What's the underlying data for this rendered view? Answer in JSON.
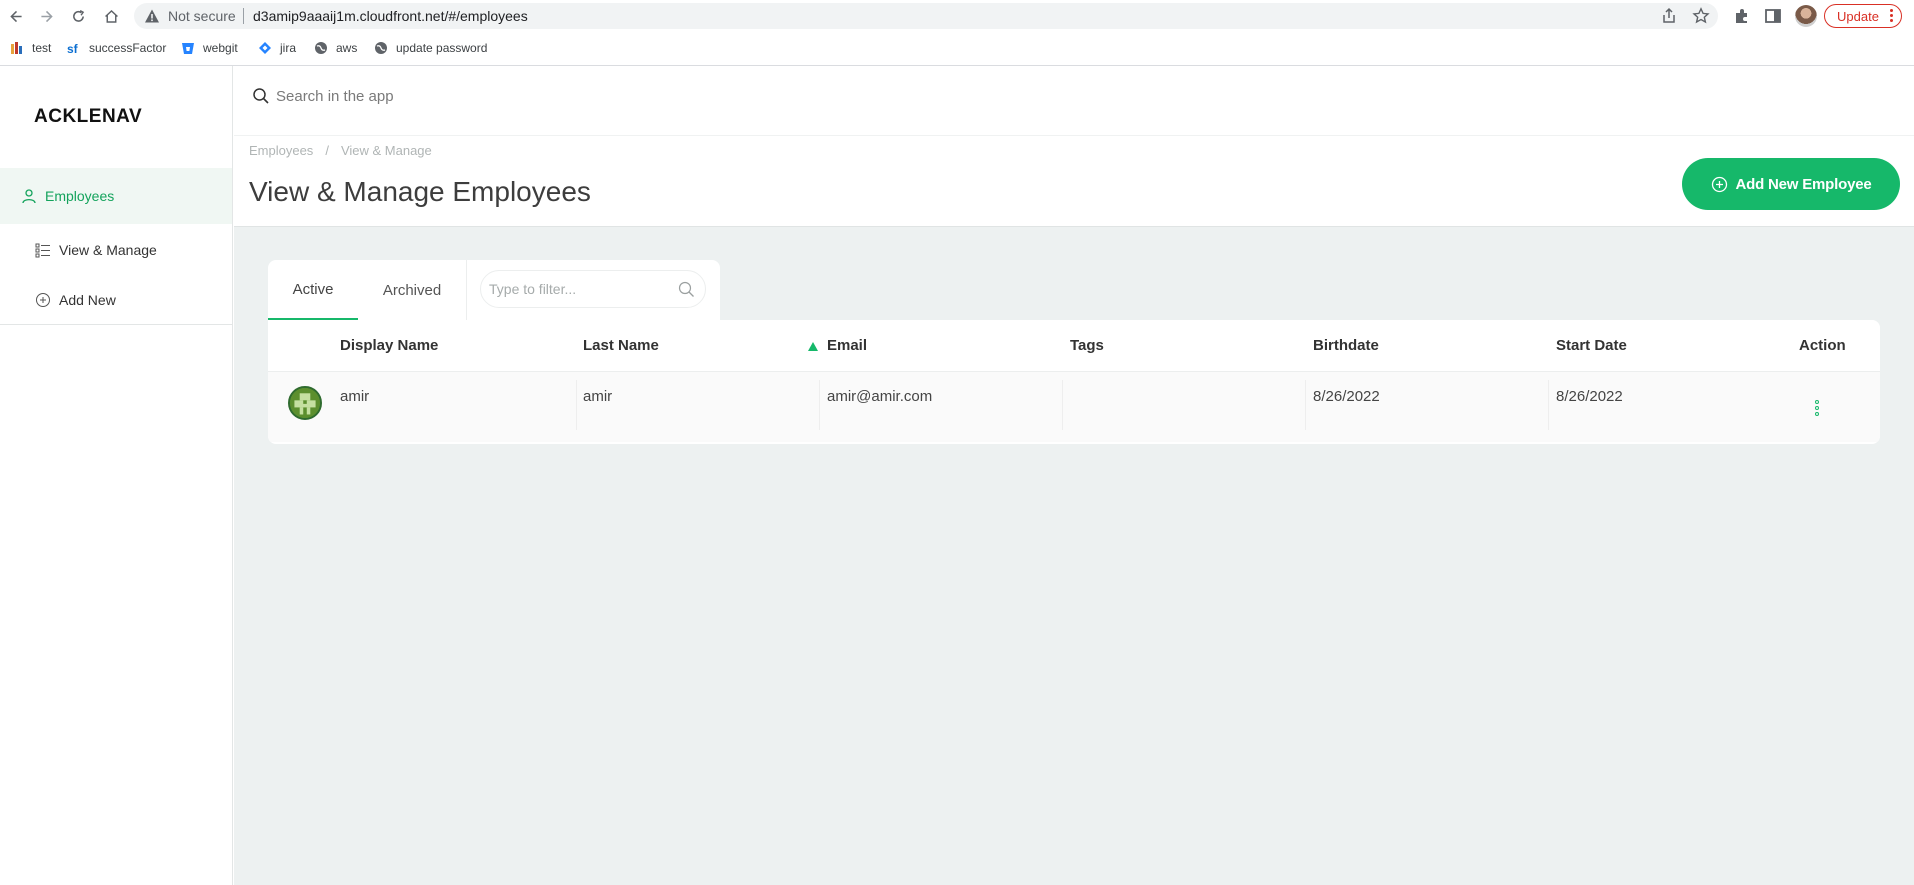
{
  "browser": {
    "not_secure": "Not secure",
    "url": "d3amip9aaaij1m.cloudfront.net/#/employees",
    "update_label": "Update",
    "bookmarks": [
      {
        "label": "test",
        "icon": "bookmark-icon"
      },
      {
        "label": "successFactor",
        "icon": "sf-icon"
      },
      {
        "label": "webgit",
        "icon": "bitbucket-icon"
      },
      {
        "label": "jira",
        "icon": "jira-icon"
      },
      {
        "label": "aws",
        "icon": "globe-icon"
      },
      {
        "label": "update password",
        "icon": "globe-icon"
      }
    ]
  },
  "app": {
    "logo": "ACKLENAV",
    "colors": {
      "accent": "#16b86a",
      "sidebar_active_bg": "#f0f7f3",
      "page_bg": "#edf1f1"
    }
  },
  "sidebar": {
    "items": [
      {
        "label": "Employees",
        "icon": "user-icon",
        "active": true
      },
      {
        "label": "View & Manage",
        "icon": "list-icon"
      },
      {
        "label": "Add New",
        "icon": "plus-circle-icon"
      }
    ]
  },
  "search": {
    "placeholder": "Search in the app"
  },
  "header": {
    "breadcrumb": [
      "Employees",
      "/",
      "View & Manage"
    ],
    "title": "View & Manage Employees",
    "add_button": "Add New Employee"
  },
  "tabs": {
    "items": [
      {
        "label": "Active",
        "active": true
      },
      {
        "label": "Archived"
      }
    ],
    "filter_placeholder": "Type to filter..."
  },
  "table": {
    "columns": [
      "Display Name",
      "Last Name",
      "Email",
      "Tags",
      "Birthdate",
      "Start Date",
      "Action"
    ],
    "sorted_column": "Email",
    "rows": [
      {
        "display_name": "amir",
        "last_name": "amir",
        "email": "amir@amir.com",
        "tags": "",
        "birthdate": "8/26/2022",
        "start_date": "8/26/2022"
      }
    ]
  }
}
